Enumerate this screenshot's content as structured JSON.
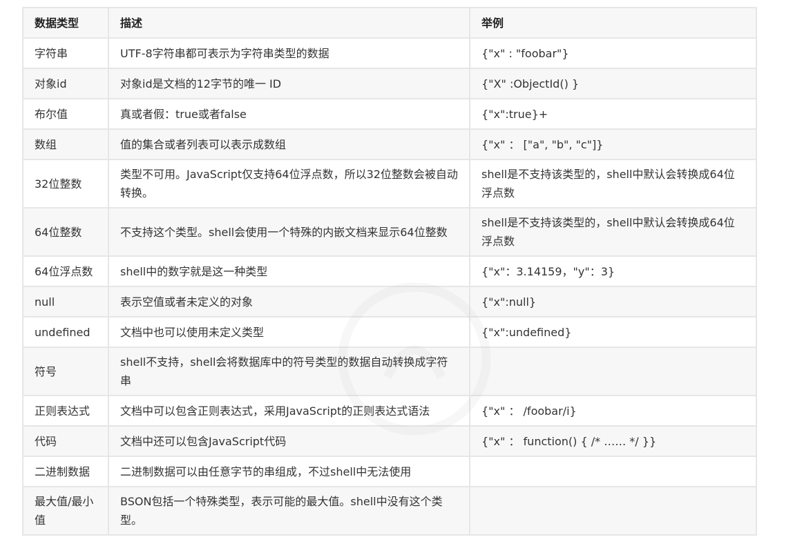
{
  "table": {
    "headers": [
      "数据类型",
      "描述",
      "举例"
    ],
    "rows": [
      {
        "type": "字符串",
        "desc": "UTF-8字符串都可表示为字符串类型的数据",
        "example": "{\"x\" : \"foobar\"}"
      },
      {
        "type": "对象id",
        "desc": "对象id是文档的12字节的唯一 ID",
        "example": "{\"X\" :ObjectId() }"
      },
      {
        "type": "布尔值",
        "desc": "真或者假：true或者false",
        "example": "{\"x\":true}+"
      },
      {
        "type": "数组",
        "desc": "值的集合或者列表可以表示成数组",
        "example": "{\"x\" ： [\"a\", \"b\", \"c\"]}"
      },
      {
        "type": "32位整数",
        "desc": "类型不可用。JavaScript仅支持64位浮点数，所以32位整数会被自动转换。",
        "example": "shell是不支持该类型的，shell中默认会转换成64位浮点数"
      },
      {
        "type": "64位整数",
        "desc": "不支持这个类型。shell会使用一个特殊的内嵌文档来显示64位整数",
        "example": "shell是不支持该类型的，shell中默认会转换成64位浮点数"
      },
      {
        "type": "64位浮点数",
        "desc": "shell中的数字就是这一种类型",
        "example": "{\"x\"：3.14159，\"y\"：3}"
      },
      {
        "type": "null",
        "desc": "表示空值或者未定义的对象",
        "example": "{\"x\":null}"
      },
      {
        "type": "undefined",
        "desc": "文档中也可以使用未定义类型",
        "example": "{\"x\":undefined}"
      },
      {
        "type": "符号",
        "desc": "shell不支持，shell会将数据库中的符号类型的数据自动转换成字符串",
        "example": ""
      },
      {
        "type": "正则表达式",
        "desc": "文档中可以包含正则表达式，采用JavaScript的正则表达式语法",
        "example": "{\"x\" ： /foobar/i}"
      },
      {
        "type": "代码",
        "desc": "文档中还可以包含JavaScript代码",
        "example": "{\"x\" ： function() { /* …… */ }}"
      },
      {
        "type": "二进制数据",
        "desc": "二进制数据可以由任意字节的串组成，不过shell中无法使用",
        "example": ""
      },
      {
        "type": "最大值/最小值",
        "desc": "BSON包括一个特殊类型，表示可能的最大值。shell中没有这个类型。",
        "example": ""
      }
    ]
  }
}
